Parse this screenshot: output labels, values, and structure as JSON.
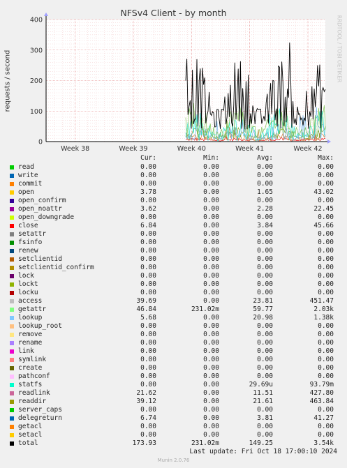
{
  "chart_data": {
    "type": "line",
    "title": "NFSv4 Client - by month",
    "ylabel": "requests / second",
    "ylim": [
      0,
      400
    ],
    "yticks": [
      0,
      100,
      200,
      300,
      400
    ],
    "xticks": [
      "Week 38",
      "Week 39",
      "Week 40",
      "Week 41",
      "Week 42"
    ],
    "grid": true,
    "series_estimate": {
      "data_start_week": 39.9,
      "total": {
        "color": "#000000",
        "mean": 149.25,
        "max": 3540
      },
      "getattr": {
        "color": "#7ec356",
        "mean": 59.77
      },
      "lookup": {
        "color": "#79b6e8",
        "mean": 20.98
      },
      "statfs": {
        "color": "#29e6ce"
      },
      "readdir": {
        "color": "#7b9d28",
        "mean": 21.61
      },
      "readlink": {
        "color": "#cc7e36",
        "mean": 11.51
      },
      "close": {
        "color": "#e41a1c",
        "mean": 3.84
      }
    }
  },
  "legend": {
    "headers": {
      "cur": "Cur:",
      "min": "Min:",
      "avg": "Avg:",
      "max": "Max:"
    },
    "rows": [
      {
        "name": "read",
        "color": "#00cc00",
        "cur": "0.00",
        "min": "0.00",
        "avg": "0.00",
        "max": "0.00"
      },
      {
        "name": "write",
        "color": "#0066b3",
        "cur": "0.00",
        "min": "0.00",
        "avg": "0.00",
        "max": "0.00"
      },
      {
        "name": "commit",
        "color": "#ff8000",
        "cur": "0.00",
        "min": "0.00",
        "avg": "0.00",
        "max": "0.00"
      },
      {
        "name": "open",
        "color": "#ffcc00",
        "cur": "3.78",
        "min": "0.00",
        "avg": "1.65",
        "max": "43.02"
      },
      {
        "name": "open_confirm",
        "color": "#330099",
        "cur": "0.00",
        "min": "0.00",
        "avg": "0.00",
        "max": "0.00"
      },
      {
        "name": "open_noattr",
        "color": "#990099",
        "cur": "3.62",
        "min": "0.00",
        "avg": "2.28",
        "max": "22.45"
      },
      {
        "name": "open_downgrade",
        "color": "#ccff00",
        "cur": "0.00",
        "min": "0.00",
        "avg": "0.00",
        "max": "0.00"
      },
      {
        "name": "close",
        "color": "#ff0000",
        "cur": "6.84",
        "min": "0.00",
        "avg": "3.84",
        "max": "45.66"
      },
      {
        "name": "setattr",
        "color": "#808080",
        "cur": "0.00",
        "min": "0.00",
        "avg": "0.00",
        "max": "0.00"
      },
      {
        "name": "fsinfo",
        "color": "#008f00",
        "cur": "0.00",
        "min": "0.00",
        "avg": "0.00",
        "max": "0.00"
      },
      {
        "name": "renew",
        "color": "#00487d",
        "cur": "0.00",
        "min": "0.00",
        "avg": "0.00",
        "max": "0.00"
      },
      {
        "name": "setclientid",
        "color": "#b35a00",
        "cur": "0.00",
        "min": "0.00",
        "avg": "0.00",
        "max": "0.00"
      },
      {
        "name": "setclientid_confirm",
        "color": "#b38f00",
        "cur": "0.00",
        "min": "0.00",
        "avg": "0.00",
        "max": "0.00"
      },
      {
        "name": "lock",
        "color": "#6b006b",
        "cur": "0.00",
        "min": "0.00",
        "avg": "0.00",
        "max": "0.00"
      },
      {
        "name": "lockt",
        "color": "#8fb300",
        "cur": "0.00",
        "min": "0.00",
        "avg": "0.00",
        "max": "0.00"
      },
      {
        "name": "locku",
        "color": "#b30000",
        "cur": "0.00",
        "min": "0.00",
        "avg": "0.00",
        "max": "0.00"
      },
      {
        "name": "access",
        "color": "#bebebe",
        "cur": "39.69",
        "min": "0.00",
        "avg": "23.81",
        "max": "451.47"
      },
      {
        "name": "getattr",
        "color": "#80ff80",
        "cur": "46.84",
        "min": "231.02m",
        "avg": "59.77",
        "max": "2.03k"
      },
      {
        "name": "lookup",
        "color": "#80c9ff",
        "cur": "5.68",
        "min": "0.00",
        "avg": "20.98",
        "max": "1.38k"
      },
      {
        "name": "lookup_root",
        "color": "#ffc080",
        "cur": "0.00",
        "min": "0.00",
        "avg": "0.00",
        "max": "0.00"
      },
      {
        "name": "remove",
        "color": "#ffe680",
        "cur": "0.00",
        "min": "0.00",
        "avg": "0.00",
        "max": "0.00"
      },
      {
        "name": "rename",
        "color": "#aa80ff",
        "cur": "0.00",
        "min": "0.00",
        "avg": "0.00",
        "max": "0.00"
      },
      {
        "name": "link",
        "color": "#ee00cc",
        "cur": "0.00",
        "min": "0.00",
        "avg": "0.00",
        "max": "0.00"
      },
      {
        "name": "symlink",
        "color": "#ff8080",
        "cur": "0.00",
        "min": "0.00",
        "avg": "0.00",
        "max": "0.00"
      },
      {
        "name": "create",
        "color": "#666600",
        "cur": "0.00",
        "min": "0.00",
        "avg": "0.00",
        "max": "0.00"
      },
      {
        "name": "pathconf",
        "color": "#ffbfff",
        "cur": "0.00",
        "min": "0.00",
        "avg": "0.00",
        "max": "0.00"
      },
      {
        "name": "statfs",
        "color": "#00ffcc",
        "cur": "0.00",
        "min": "0.00",
        "avg": "29.69u",
        "max": "93.79m"
      },
      {
        "name": "readlink",
        "color": "#cc6699",
        "cur": "21.62",
        "min": "0.00",
        "avg": "11.51",
        "max": "427.80"
      },
      {
        "name": "readdir",
        "color": "#999900",
        "cur": "39.12",
        "min": "0.00",
        "avg": "21.61",
        "max": "463.84"
      },
      {
        "name": "server_caps",
        "color": "#00cc00",
        "cur": "0.00",
        "min": "0.00",
        "avg": "0.00",
        "max": "0.00"
      },
      {
        "name": "delegreturn",
        "color": "#0066b3",
        "cur": "6.74",
        "min": "0.00",
        "avg": "3.81",
        "max": "41.27"
      },
      {
        "name": "getacl",
        "color": "#ff8000",
        "cur": "0.00",
        "min": "0.00",
        "avg": "0.00",
        "max": "0.00"
      },
      {
        "name": "setacl",
        "color": "#ffcc00",
        "cur": "0.00",
        "min": "0.00",
        "avg": "0.00",
        "max": "0.00"
      },
      {
        "name": "total",
        "color": "#000000",
        "cur": "173.93",
        "min": "231.02m",
        "avg": "149.25",
        "max": "3.54k"
      }
    ]
  },
  "footer": {
    "last_update": "Last update: Fri Oct 18 17:00:10 2024",
    "version": "Munin 2.0.76"
  },
  "watermark": "RRDTOOL / TOBI OETIKER"
}
